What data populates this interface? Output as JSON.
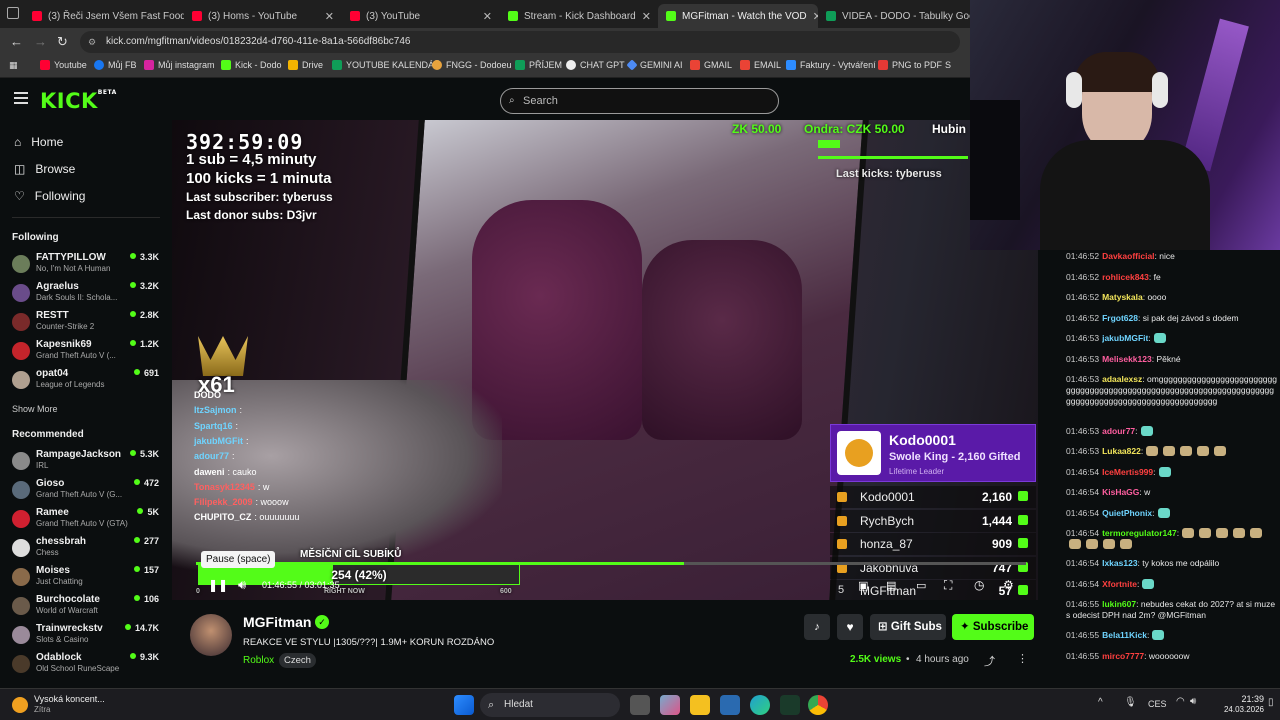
{
  "tabs": [
    {
      "label": "(3) Řeči Jsem Všem Fast Foodi",
      "color": "#ff0033"
    },
    {
      "label": "(3) Homs - YouTube",
      "color": "#ff0033"
    },
    {
      "label": "(3) YouTube",
      "color": "#ff0033"
    },
    {
      "label": "Stream - Kick Dashboard",
      "color": "#53fc18"
    },
    {
      "label": "MGFitman - Watch the VOD",
      "color": "#53fc18"
    },
    {
      "label": "VIDEA - DODO - Tabulky Googl",
      "color": "#0f9d58"
    }
  ],
  "url": "kick.com/mgfitman/videos/018232d4-d760-411e-8a1a-566df86bc746",
  "bookmarks": [
    {
      "label": "Youtube",
      "color": "#ff0033"
    },
    {
      "label": "Můj FB",
      "color": "#1877f2"
    },
    {
      "label": "Můj instagram",
      "color": "#d6249f"
    },
    {
      "label": "Kick - Dodo",
      "color": "#53fc18"
    },
    {
      "label": "Drive",
      "color": "#f4b400"
    },
    {
      "label": "YOUTUBE KALENDÁŘ",
      "color": "#0f9d58"
    },
    {
      "label": "FNGG - Dodoeu",
      "color": "#e8a33d"
    },
    {
      "label": "PŘÍJEM",
      "color": "#0f9d58"
    },
    {
      "label": "CHAT GPT",
      "color": "#eeeeee"
    },
    {
      "label": "GEMINI AI",
      "color": "#4d8bf5"
    },
    {
      "label": "GMAIL",
      "color": "#ea4335"
    },
    {
      "label": "EMAIL",
      "color": "#ea4335"
    },
    {
      "label": "Faktury - Vytváření",
      "color": "#2d8cff"
    },
    {
      "label": "PNG to PDF",
      "color": "#e53935"
    },
    {
      "label": "S",
      "color": "#888888"
    }
  ],
  "brand": {
    "logo": "KICK",
    "beta": "BETA",
    "accent": "#53fc18"
  },
  "search": {
    "placeholder": "Search"
  },
  "nav": {
    "home": "Home",
    "browse": "Browse",
    "following": "Following"
  },
  "following_header": "Following",
  "following": [
    {
      "name": "FATTYPILLOW",
      "game": "No, I'm Not A Human",
      "viewers": "3.3K",
      "color": "#6b7d5a"
    },
    {
      "name": "Agraelus",
      "game": "Dark Souls II: Schola...",
      "viewers": "3.2K",
      "color": "#6a4c8a"
    },
    {
      "name": "RESTT",
      "game": "Counter-Strike 2",
      "viewers": "2.8K",
      "color": "#7a2a2a"
    },
    {
      "name": "Kapesnik69",
      "game": "Grand Theft Auto V (...",
      "viewers": "1.2K",
      "color": "#c4242b"
    },
    {
      "name": "opat04",
      "game": "League of Legends",
      "viewers": "691",
      "color": "#b0a090"
    }
  ],
  "show_more": "Show More",
  "recommended_header": "Recommended",
  "recommended": [
    {
      "name": "RampageJackson",
      "game": "IRL",
      "viewers": "5.3K",
      "color": "#8a8a8a"
    },
    {
      "name": "Gioso",
      "game": "Grand Theft Auto V (G...",
      "viewers": "472",
      "color": "#5a6a7a"
    },
    {
      "name": "Ramee",
      "game": "Grand Theft Auto V (GTA)",
      "viewers": "5K",
      "color": "#d02030"
    },
    {
      "name": "chessbrah",
      "game": "Chess",
      "viewers": "277",
      "color": "#dddddd"
    },
    {
      "name": "Moises",
      "game": "Just Chatting",
      "viewers": "157",
      "color": "#8a6a4a"
    },
    {
      "name": "Burchocolate",
      "game": "World of Warcraft",
      "viewers": "106",
      "color": "#6a5a4a"
    },
    {
      "name": "Trainwreckstv",
      "game": "Slots & Casino",
      "viewers": "14.7K",
      "color": "#9a8a9a"
    },
    {
      "name": "Odablock",
      "game": "Old School RuneScape",
      "viewers": "9.3K",
      "color": "#4a3a2a"
    }
  ],
  "overlay": {
    "timer": "392:59:09",
    "line1": "1 sub = 4,5 minuty",
    "line2": "100 kicks = 1 minuta",
    "last_sub": "Last subscriber: tyberuss",
    "last_donor": "Last donor subs: D3jvr",
    "top_right_1": "ZK 50.00",
    "top_right_2": "Ondra: CZK 50.00",
    "top_right_3": "Hubin",
    "last_kicks": "Last kicks: tyberuss",
    "badge": "x61",
    "goal_title": "MĚSÍČNÍ CÍL SUBÍKŮ",
    "goal_value": "254 (42%)",
    "goal_progress": 0.42,
    "goal_left": "0",
    "goal_mid": "RIGHT NOW",
    "goal_right": "600",
    "leader_name": "Kodo0001",
    "leader_sub": "Swole King - 2,160 Gifted",
    "leader_tag": "Lifetime Leader",
    "leaderboard": [
      {
        "rank": "",
        "name": "Kodo0001",
        "value": "2,160"
      },
      {
        "rank": "",
        "name": "RychBych",
        "value": "1,444"
      },
      {
        "rank": "",
        "name": "honza_87",
        "value": "909"
      },
      {
        "rank": "",
        "name": "Jakobnuva",
        "value": "747"
      },
      {
        "rank": "5",
        "name": "MGFitman",
        "value": "57"
      }
    ]
  },
  "overlay_chat": [
    {
      "user": "DODO",
      "text": "",
      "color": "#ffffff"
    },
    {
      "user": "ItzSajmon",
      "text": ":",
      "color": "#6fd4ff"
    },
    {
      "user": "Spartq16",
      "text": ":",
      "color": "#6fd4ff"
    },
    {
      "user": "jakubMGFit",
      "text": ":",
      "color": "#6fd4ff"
    },
    {
      "user": "adour77",
      "text": ":",
      "color": "#6fd4ff"
    },
    {
      "user": "daweni",
      "text": ": cauko",
      "color": "#ffffff"
    },
    {
      "user": "Tonasyk12345",
      "text": ": w",
      "color": "#ff6060"
    },
    {
      "user": "Filipekk_2009",
      "text": ": wooow",
      "color": "#ff6060"
    },
    {
      "user": "CHUPITO_CZ",
      "text": ": ouuuuuuu",
      "color": "#ffffff"
    }
  ],
  "player": {
    "tooltip": "Pause (space)",
    "time": "01:46:55 / 03:01:35",
    "progress": 0.588
  },
  "streamer": {
    "name": "MGFitman",
    "title": "REAKCE VE STYLU |1305/???| 1.9M+ KORUN ROZDÁNO",
    "category": "Roblox",
    "tag": "Czech",
    "views": "2.5K views",
    "ago": "4 hours ago",
    "gift_label": "Gift Subs",
    "subscribe_label": "Subscribe"
  },
  "chat": [
    {
      "time": "01:46:52",
      "user": "Davkaofficial",
      "text": ": nice",
      "color": "#ff4040",
      "emotes": 0
    },
    {
      "time": "01:46:52",
      "user": "rohlicek843",
      "text": ": fe",
      "color": "#ff4040",
      "emotes": 0
    },
    {
      "time": "01:46:52",
      "user": "Matyskala",
      "text": ": oooo",
      "color": "#f2e55b",
      "emotes": 0
    },
    {
      "time": "01:46:52",
      "user": "Frgot628",
      "text": ": si pak dej závod s dodem",
      "color": "#6fd4ff",
      "emotes": 0
    },
    {
      "time": "01:46:53",
      "user": "jakubMGFit",
      "text": ":",
      "color": "#6fd4ff",
      "emotes": 1
    },
    {
      "time": "01:46:53",
      "user": "Melisekk123",
      "text": ": Pěkné",
      "color": "#ff5fa0",
      "emotes": 0
    },
    {
      "time": "01:46:53",
      "user": "adaalexsz",
      "text": ": omggggggggggggggggggggggggggggggggggggggggggggggggggggggggggggggggggggggggggggggggggggggggggggggggggggg",
      "color": "#f2e55b",
      "emotes": 0
    },
    {
      "time": "01:46:53",
      "user": "adour77",
      "text": ":",
      "color": "#ff5fa0",
      "emotes": 1
    },
    {
      "time": "01:46:53",
      "user": "Lukaa822",
      "text": ":",
      "color": "#f2e55b",
      "emotes": 5
    },
    {
      "time": "01:46:54",
      "user": "IceMertis999",
      "text": ":",
      "color": "#ff4040",
      "emotes": 1
    },
    {
      "time": "01:46:54",
      "user": "KisHaGG",
      "text": ": w",
      "color": "#ff5fa0",
      "emotes": 0
    },
    {
      "time": "01:46:54",
      "user": "QuietPhonix",
      "text": ":",
      "color": "#6fd4ff",
      "emotes": 1
    },
    {
      "time": "01:46:54",
      "user": "termoregulator147",
      "text": ":",
      "color": "#53fc18",
      "emotes": 9
    },
    {
      "time": "01:46:54",
      "user": "Ixkas123",
      "text": ": ty kokos me odpálilo",
      "color": "#6fd4ff",
      "emotes": 0
    },
    {
      "time": "01:46:54",
      "user": "Xfortnite",
      "text": ":",
      "color": "#ff4040",
      "emotes": 1
    },
    {
      "time": "01:46:55",
      "user": "lukin607",
      "text": ": nebudes cekat do 2027? at si muzes odecist DPH nad 2m? @MGFitman",
      "color": "#53fc18",
      "emotes": 0
    },
    {
      "time": "01:46:55",
      "user": "Bela11Kick",
      "text": ":",
      "color": "#6fd4ff",
      "emotes": 1
    },
    {
      "time": "01:46:55",
      "user": "mirco7777",
      "text": ": woooooow",
      "color": "#ff4040",
      "emotes": 0
    }
  ],
  "taskbar": {
    "weather": "Vysoká koncent...",
    "weather_sub": "Zítra",
    "search": "Hledat",
    "lang": "CES",
    "time": "21:39",
    "date": "24.03.2026"
  }
}
